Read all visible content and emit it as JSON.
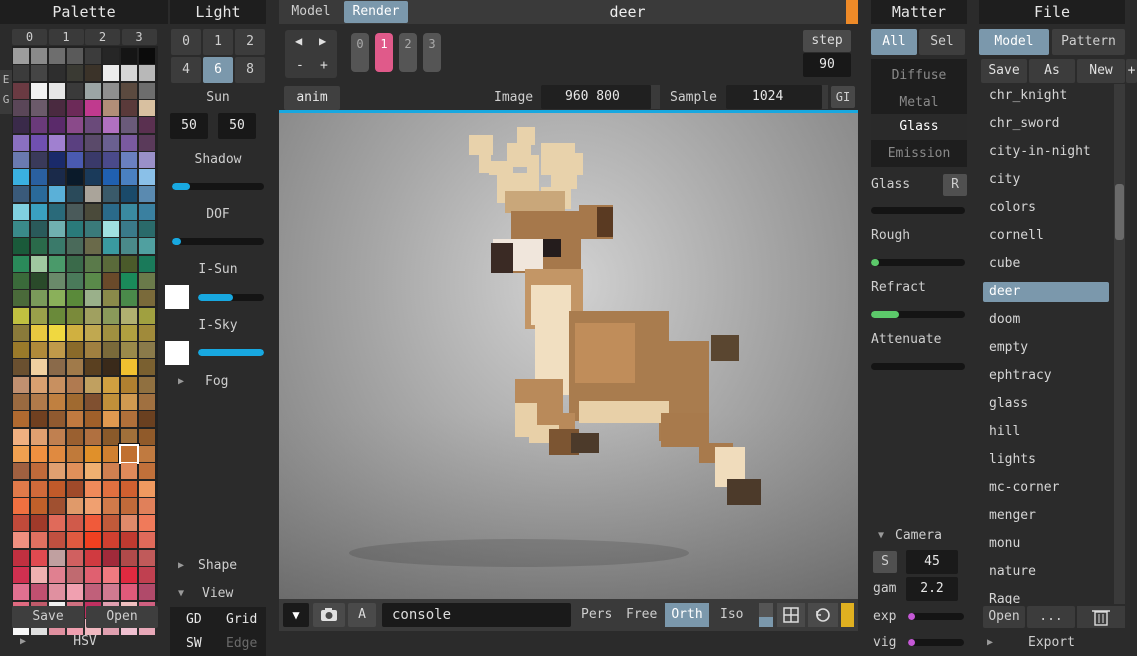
{
  "colors": {
    "accent": "#18a8e0",
    "active": "#7b98ac",
    "pink": "#e05a8a",
    "green": "#5cc96a",
    "magenta": "#c558d6",
    "yellow": "#e0b020",
    "orange": "#ee8a28",
    "panel": "#2b2b2b"
  },
  "palette": {
    "title": "Palette",
    "tabs": [
      "0",
      "1",
      "2",
      "3"
    ],
    "side_tabs": [
      "E",
      "G"
    ],
    "save": "Save",
    "open": "Open",
    "hsv": "HSV",
    "swatches": [
      "#9d9d9d",
      "#8a8a8a",
      "#6e6e6e",
      "#5a5a5a",
      "#3c3c3c",
      "#262626",
      "#151515",
      "#0b0b0b",
      "#3b3b3b",
      "#454545",
      "#2e2e2e",
      "#3a3a33",
      "#3b3329",
      "#ececec",
      "#d6d6d6",
      "#b8b8b8",
      "#6a3a42",
      "#f2f2f2",
      "#e6e6e6",
      "#3a3a3a",
      "#9ba5a5",
      "#909090",
      "#5b4a3f",
      "#6d6d6d",
      "#5a4658",
      "#6b5a6a",
      "#4a2a40",
      "#6c2a58",
      "#c03a8e",
      "#b28e78",
      "#5a3a3a",
      "#d8c0a0",
      "#3a2a4a",
      "#6a3a7a",
      "#5a2a6a",
      "#8a4a8a",
      "#6a4a7a",
      "#b070c0",
      "#6a5a7a",
      "#5a3050",
      "#8a70c0",
      "#7050b0",
      "#a080d0",
      "#5a4080",
      "#5a4a6a",
      "#6a6090",
      "#7a5aa0",
      "#5a3a5a",
      "#6a7ab0",
      "#3a3a5a",
      "#1a2a6a",
      "#4a5ab0",
      "#3a3a6a",
      "#4a4a8a",
      "#6a80c0",
      "#9a90c8",
      "#3ab0e0",
      "#2a60a0",
      "#1a2a4a",
      "#0a1a2a",
      "#1a3a5a",
      "#2060b0",
      "#4a80c0",
      "#8ac0e8",
      "#3a5a7a",
      "#2a6a9a",
      "#5ab0d8",
      "#2a4a5a",
      "#aaa49a",
      "#3a5a6a",
      "#1a4a6a",
      "#5a8ab0",
      "#80d0e0",
      "#3aa0c0",
      "#2a6a7a",
      "#4a5a5a",
      "#4a4a3a",
      "#2a6a8a",
      "#3a8aa0",
      "#3a80a0",
      "#3a8a8a",
      "#2a5a5a",
      "#70b0b0",
      "#2a7a7a",
      "#3a7a7a",
      "#a0e0e0",
      "#3a7a8a",
      "#2a6a6a",
      "#1a5a3a",
      "#2a6a4a",
      "#3a7a6a",
      "#4a6a5a",
      "#6a6a4a",
      "#3a9aa0",
      "#4a8a8a",
      "#50a0a0",
      "#2a8a5a",
      "#a0c8a0",
      "#4a9a6a",
      "#3a6a4a",
      "#5a7a4a",
      "#5a6a3a",
      "#4a5a2a",
      "#1a7a5a",
      "#3a6a3a",
      "#2a4a2a",
      "#6a8a6a",
      "#4a7a5a",
      "#5a8a4a",
      "#6a4a2a",
      "#1a8a5a",
      "#6a7a4a",
      "#4a6a3a",
      "#7a9a5a",
      "#8ab05a",
      "#5a8a3a",
      "#9ab08a",
      "#8a8a4a",
      "#4a8a4a",
      "#7a6a3a",
      "#c0c040",
      "#9aa04a",
      "#6a8a3a",
      "#7a8a3a",
      "#a0a060",
      "#8a9a5a",
      "#b0b070",
      "#a0a040",
      "#8a7a3a",
      "#e8c840",
      "#f0d840",
      "#d0b040",
      "#c0a850",
      "#a09040",
      "#b0a040",
      "#a08a3a",
      "#9a7a2a",
      "#b08a3a",
      "#c09a4a",
      "#8a6a2a",
      "#a08040",
      "#7a6a3a",
      "#9a8a4a",
      "#8a7a4a",
      "#6a5030",
      "#f0d0a0",
      "#8a6a4a",
      "#a07a4a",
      "#5a4020",
      "#3a2a1a",
      "#f0c030",
      "#7a6030",
      "#c09070",
      "#d8a070",
      "#c89060",
      "#b07a50",
      "#c0a060",
      "#d0a040",
      "#b08030",
      "#907040",
      "#9a6a40",
      "#b07a4a",
      "#c08040",
      "#a06a30",
      "#805030",
      "#c0903a",
      "#d09a50",
      "#a07040",
      "#b06a30",
      "#704020",
      "#905a30",
      "#c07a40",
      "#a0602a",
      "#e09a50",
      "#b0703a",
      "#6a4020",
      "#f0b080",
      "#e0a070",
      "#c08050",
      "#9a6030",
      "#b07040",
      "#8a5a2a",
      "#a0703a",
      "#905a2a",
      "#f0a050",
      "#f09040",
      "#e08a40",
      "#c07a3a",
      "#e0902a",
      "#d08030",
      "#c07030",
      "#c07a40",
      "#a06040",
      "#c06a3a",
      "#e0a070",
      "#e0905a",
      "#f0b070",
      "#d08050",
      "#e08a5a",
      "#c0703a",
      "#e07a4a",
      "#d06a3a",
      "#c05a2a",
      "#a04a2a",
      "#f08a5a",
      "#e07040",
      "#d06030",
      "#f09a60",
      "#f07040",
      "#c0602a",
      "#a05030",
      "#e09a6a",
      "#f0a070",
      "#d07a4a",
      "#c06a3a",
      "#e0805a",
      "#c04a3a",
      "#a03a2a",
      "#e06a5a",
      "#d05a4a",
      "#f05a3a",
      "#c05a3a",
      "#e08a6a",
      "#f07a5a",
      "#f09080",
      "#e07060",
      "#c05040",
      "#e05a40",
      "#f04020",
      "#d04030",
      "#c03a30",
      "#e06a5a",
      "#c03040",
      "#e04a50",
      "#c0a0a0",
      "#d06060",
      "#d03a40",
      "#a02a3a",
      "#b04a4a",
      "#c05a5a",
      "#d03050",
      "#f0b0b0",
      "#e08090",
      "#c06a70",
      "#e06070",
      "#f07a80",
      "#e02a40",
      "#c04050",
      "#e07090",
      "#c05070",
      "#e090a0",
      "#f0a0b0",
      "#c0607a",
      "#d07a90",
      "#e05a7a",
      "#b04a6a",
      "#e06a80",
      "#c05a6a",
      "#f0f0f0",
      "#d07080",
      "#c03060",
      "#e0a0b0",
      "#f0c0c0",
      "#d06080",
      "#f8f8f8",
      "#e0e0e0",
      "#e090a0",
      "#f0a0b0",
      "#f0b8c0",
      "#e0a0b0",
      "#f0c0d0",
      "#e8a8b8"
    ]
  },
  "light": {
    "title": "Light",
    "grid": [
      "0",
      "1",
      "2",
      "4",
      "6",
      "8"
    ],
    "sun_label": "Sun",
    "sun_x": "50",
    "sun_y": "50",
    "shadow_label": "Shadow",
    "shadow": 0.2,
    "dof_label": "DOF",
    "dof": 0.1,
    "isun_label": "I-Sun",
    "isun": 0.53,
    "isky_label": "I-Sky",
    "isky": 1.0,
    "fog_label": "Fog",
    "shape_label": "Shape",
    "view_label": "View",
    "gd": "GD",
    "grid_btn": "Grid",
    "sw": "SW",
    "edge": "Edge"
  },
  "center": {
    "tab_model": "Model",
    "tab_render": "Render",
    "file_name": "deer",
    "nav": {
      "prev": "◀",
      "next": "▶",
      "minus": "-",
      "plus": "+"
    },
    "frames": [
      "0",
      "1",
      "2",
      "3"
    ],
    "step_label": "step",
    "step_value": "90",
    "anim_tab": "anim",
    "image_label": "Image",
    "image_size": "960 800",
    "sample_label": "Sample",
    "sample_value": "1024",
    "gi": "GI",
    "console": "console",
    "a_btn": "A",
    "views": [
      "Pers",
      "Free",
      "Orth",
      "Iso"
    ]
  },
  "matter": {
    "title": "Matter",
    "all": "All",
    "sel": "Sel",
    "types": [
      "Diffuse",
      "Metal",
      "Glass",
      "Emission"
    ],
    "glass_label": "Glass",
    "r": "R",
    "glass": 0.0,
    "rough_label": "Rough",
    "rough": 0.08,
    "refract_label": "Refract",
    "refract": 0.3,
    "attenuate_label": "Attenuate",
    "attenuate": 0.0,
    "camera_label": "Camera",
    "s": "S",
    "s_value": "45",
    "gam_label": "gam",
    "gam_value": "2.2",
    "exp_label": "exp",
    "exp": 0.12,
    "vig_label": "vig",
    "vig": 0.12
  },
  "file": {
    "title": "File",
    "tab_model": "Model",
    "tab_pattern": "Pattern",
    "save": "Save",
    "as": "As",
    "new": "New",
    "plus": "+",
    "items": [
      "chr_knight",
      "chr_sword",
      "city-in-night",
      "city",
      "colors",
      "cornell",
      "cube",
      "deer",
      "doom",
      "empty",
      "ephtracy",
      "glass",
      "hill",
      "lights",
      "mc-corner",
      "menger",
      "monu",
      "nature",
      "Rage"
    ],
    "selected": "deer",
    "open": "Open",
    "more": "...",
    "export": "Export"
  }
}
